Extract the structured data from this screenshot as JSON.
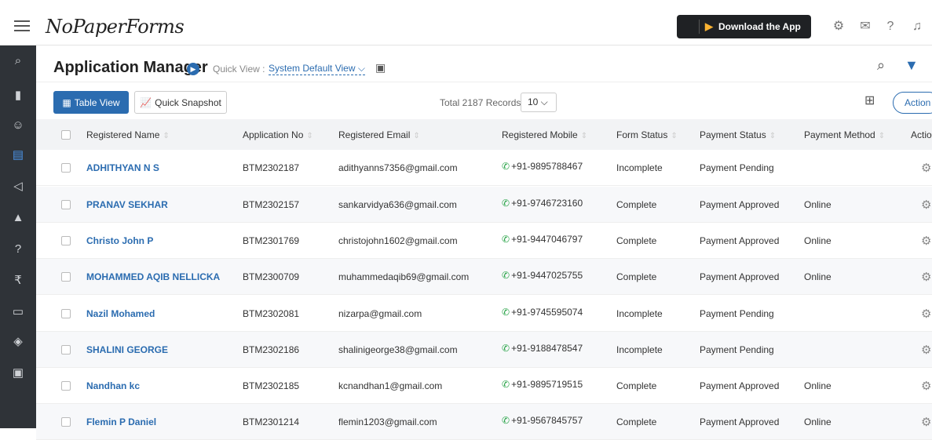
{
  "header": {
    "logo": "NoPaperForms",
    "download_label": "Download the App"
  },
  "page": {
    "title": "Application Manager",
    "quick_view_label": "Quick View :",
    "quick_view_value": "System Default View ⌵"
  },
  "toolbar": {
    "table_view_label": "Table View",
    "snapshot_label": "Quick Snapshot",
    "records_text": "Total 2187 Records",
    "per_page": "10 ⌵",
    "action_label": "Action"
  },
  "columns": [
    "Registered Name",
    "Application No",
    "Registered Email",
    "Registered Mobile",
    "Form Status",
    "Payment Status",
    "Payment Method",
    "Actio"
  ],
  "rows": [
    {
      "name": "ADHITHYAN N S",
      "app_no": "BTM2302187",
      "email": "adithyanns7356@gmail.com",
      "mobile": "+91-9895788467",
      "form_status": "Incomplete",
      "payment_status": "Payment Pending",
      "payment_method": ""
    },
    {
      "name": "PRANAV SEKHAR",
      "app_no": "BTM2302157",
      "email": "sankarvidya636@gmail.com",
      "mobile": "+91-9746723160",
      "form_status": "Complete",
      "payment_status": "Payment Approved",
      "payment_method": "Online"
    },
    {
      "name": "Christo John P",
      "app_no": "BTM2301769",
      "email": "christojohn1602@gmail.com",
      "mobile": "+91-9447046797",
      "form_status": "Complete",
      "payment_status": "Payment Approved",
      "payment_method": "Online"
    },
    {
      "name": "MOHAMMED AQIB NELLICKA",
      "app_no": "BTM2300709",
      "email": "muhammedaqib69@gmail.com",
      "mobile": "+91-9447025755",
      "form_status": "Complete",
      "payment_status": "Payment Approved",
      "payment_method": "Online"
    },
    {
      "name": "Nazil Mohamed",
      "app_no": "BTM2302081",
      "email": "nizarpa@gmail.com",
      "mobile": "+91-9745595074",
      "form_status": "Incomplete",
      "payment_status": "Payment Pending",
      "payment_method": ""
    },
    {
      "name": "SHALINI GEORGE",
      "app_no": "BTM2302186",
      "email": "shalinigeorge38@gmail.com",
      "mobile": "+91-9188478547",
      "form_status": "Incomplete",
      "payment_status": "Payment Pending",
      "payment_method": ""
    },
    {
      "name": "Nandhan kc",
      "app_no": "BTM2302185",
      "email": "kcnandhan1@gmail.com",
      "mobile": "+91-9895719515",
      "form_status": "Complete",
      "payment_status": "Payment Approved",
      "payment_method": "Online"
    },
    {
      "name": "Flemin P Daniel",
      "app_no": "BTM2301214",
      "email": "flemin1203@gmail.com",
      "mobile": "+91-9567845757",
      "form_status": "Complete",
      "payment_status": "Payment Approved",
      "payment_method": "Online"
    }
  ],
  "colors": {
    "accent": "#2b6cb0",
    "sidebar": "#2f3338",
    "whatsapp": "#25a244"
  }
}
